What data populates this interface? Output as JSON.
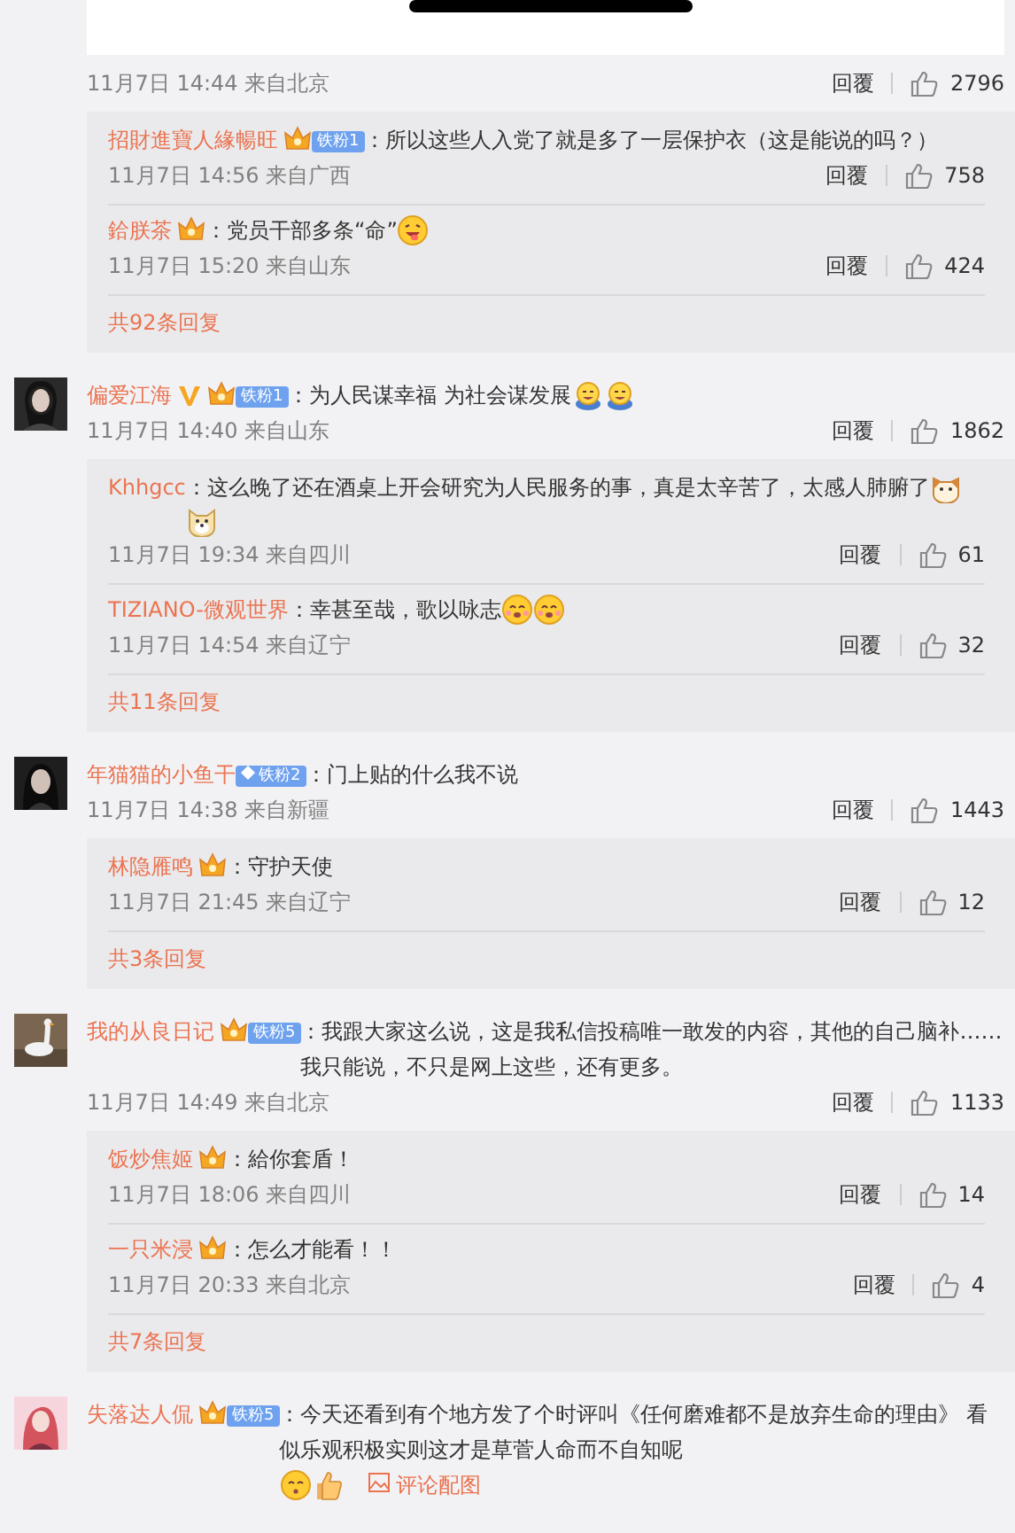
{
  "top_picture": {
    "kind": "picture"
  },
  "comments": [
    {
      "time": "11月7日 14:44 来自北京",
      "reply": "回覆",
      "likes": "2796",
      "replies": [
        {
          "name": "招財進寶人緣暢旺",
          "crown": true,
          "fan_badge": "铁粉1",
          "text": "：所以这些人入党了就是多了一层保护衣（这是能说的吗？）",
          "time": "11月7日 14:56 来自广西",
          "reply": "回覆",
          "likes": "758"
        },
        {
          "name": "鉿朕茶",
          "crown": true,
          "text": "：党员干部多条“命”",
          "emojis": [
            {
              "kind": "tongue"
            }
          ],
          "time": "11月7日 15:20 来自山东",
          "reply": "回覆",
          "likes": "424"
        }
      ],
      "more": "共92条回复"
    },
    {
      "avatar": {
        "kind": "picture"
      },
      "name": "偏爱江海",
      "verified": true,
      "crown": true,
      "fan_badge": "铁粉1",
      "text": "：为人民谋幸福 为社会谋发展",
      "emojis": [
        {
          "kind": "laugh"
        },
        {
          "kind": "laugh"
        }
      ],
      "time": "11月7日 14:40 来自山东",
      "reply": "回覆",
      "likes": "1862",
      "replies": [
        {
          "name": "Khhgcc",
          "text": "：这么晚了还在酒桌上开会研究为人民服务的事，真是太辛苦了，太感人肺腑了",
          "emojis": [
            {
              "kind": "cat"
            },
            {
              "kind": "dog"
            }
          ],
          "time": "11月7日 19:34 来自四川",
          "reply": "回覆",
          "likes": "61"
        },
        {
          "name": "TIZIANO-微观世界",
          "text": "：幸甚至哉，歌以咏志",
          "emojis": [
            {
              "kind": "blush"
            },
            {
              "kind": "blush"
            }
          ],
          "time": "11月7日 14:54 来自辽宁",
          "reply": "回覆",
          "likes": "32"
        }
      ],
      "more": "共11条回复"
    },
    {
      "avatar": {
        "kind": "picture"
      },
      "name": "年猫猫的小鱼干",
      "fan_badge": "铁粉2",
      "fan_diamond": true,
      "text": "：门上贴的什么我不说",
      "time": "11月7日 14:38 来自新疆",
      "reply": "回覆",
      "likes": "1443",
      "replies": [
        {
          "name": "林隐雁鸣",
          "crown": true,
          "text": "：守护天使",
          "time": "11月7日 21:45 来自辽宁",
          "reply": "回覆",
          "likes": "12"
        }
      ],
      "more": "共3条回复"
    },
    {
      "avatar": {
        "kind": "picture"
      },
      "name": "我的从良日记",
      "crown": true,
      "fan_badge": "铁粉5",
      "text": "：我跟大家这么说，这是我私信投稿唯一敢发的内容，其他的自己脑补……我只能说，不只是网上这些，还有更多。",
      "time": "11月7日 14:49 来自北京",
      "reply": "回覆",
      "likes": "1133",
      "replies": [
        {
          "name": "饭炒焦姬",
          "crown": true,
          "text": "：給你套盾！",
          "time": "11月7日 18:06 来自四川",
          "reply": "回覆",
          "likes": "14"
        },
        {
          "name": "一只米浸",
          "crown": true,
          "text": "：怎么才能看！！",
          "time": "11月7日 20:33 来自北京",
          "reply": "回覆",
          "likes": "4"
        }
      ],
      "more": "共7条回复"
    },
    {
      "avatar": {
        "kind": "picture"
      },
      "name": "失落达人侃",
      "crown": true,
      "fan_badge": "铁粉5",
      "text": "：今天还看到有个地方发了个时评叫《任何磨难都不是放弃生命的理由》 看似乐观积极实则这才是草菅人命而不自知呢",
      "emojis": [
        {
          "kind": "kiss"
        },
        {
          "kind": "thumb"
        }
      ],
      "image_link": "评论配图"
    }
  ]
}
